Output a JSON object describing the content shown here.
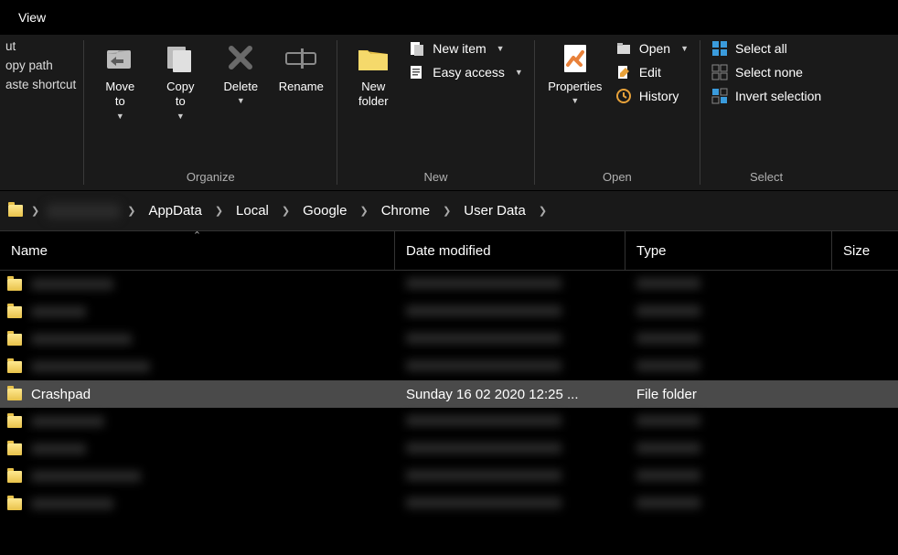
{
  "tabs": {
    "view": "View"
  },
  "ribbon": {
    "clipboard": {
      "cut": "ut",
      "copy_path": "opy path",
      "paste_shortcut": "aste shortcut"
    },
    "organize": {
      "label": "Organize",
      "move_to": "Move\nto",
      "copy_to": "Copy\nto",
      "delete": "Delete",
      "rename": "Rename"
    },
    "new_group": {
      "label": "New",
      "new_folder": "New\nfolder",
      "new_item": "New item",
      "easy_access": "Easy access"
    },
    "open_group": {
      "label": "Open",
      "properties": "Properties",
      "open": "Open",
      "edit": "Edit",
      "history": "History"
    },
    "select_group": {
      "label": "Select",
      "select_all": "Select all",
      "select_none": "Select none",
      "invert": "Invert selection"
    }
  },
  "breadcrumb": {
    "items": [
      "AppData",
      "Local",
      "Google",
      "Chrome",
      "User Data"
    ]
  },
  "columns": {
    "name": "Name",
    "date": "Date modified",
    "type": "Type",
    "size": "Size"
  },
  "selected_row": {
    "name": "Crashpad",
    "date": "Sunday 16 02 2020 12:25 ...",
    "type": "File folder"
  }
}
